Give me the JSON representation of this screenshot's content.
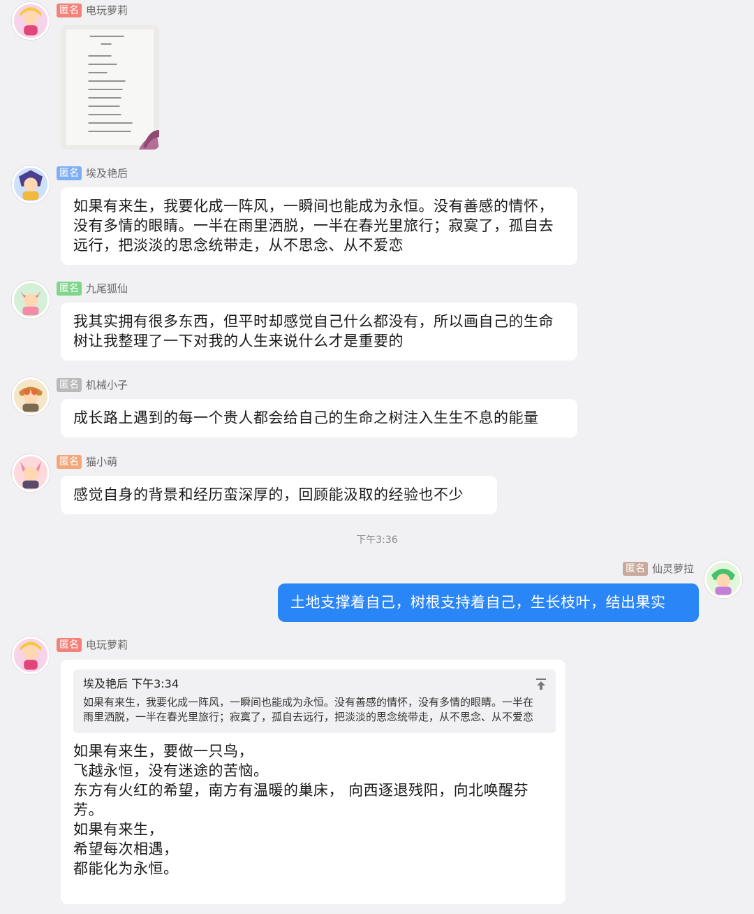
{
  "chat": {
    "anon_label": "匿名",
    "messages": [
      {
        "sender": "电玩萝莉",
        "type": "image"
      },
      {
        "sender": "埃及艳后",
        "text": "如果有来生，我要化成一阵风，一瞬间也能成为永恒。没有善感的情怀，没有多情的眼睛。一半在雨里洒脱，一半在春光里旅行；寂寞了，孤自去远行，把淡淡的思念统带走，从不思念、从不爱恋"
      },
      {
        "sender": "九尾狐仙",
        "text": "我其实拥有很多东西，但平时却感觉自己什么都没有，所以画自己的生命树让我整理了一下对我的人生来说什么才是重要的"
      },
      {
        "sender": "机械小子",
        "text": "成长路上遇到的每一个贵人都会给自己的生命之树注入生生不息的能量"
      },
      {
        "sender": "猫小萌",
        "text": "感觉自身的背景和经历蛮深厚的，回顾能汲取的经验也不少"
      },
      {
        "sender": "仙灵萝拉",
        "text": "土地支撑着自己，树根支持着自己，生长枝叶，结出果实"
      },
      {
        "sender": "电玩萝莉",
        "quote": {
          "sender": "埃及艳后",
          "time": "下午3:34",
          "text": "如果有来生，我要化成一阵风，一瞬间也能成为永恒。没有善感的情怀，没有多情的眼睛。一半在雨里洒脱，一半在春光里旅行；寂寞了，孤自去远行，把淡淡的思念统带走，从不思念、从不爱恋"
        },
        "text": "如果有来生，要做一只鸟，\n飞越永恒，没有迷途的苦恼。\n东方有火红的希望，南方有温暖的巢床， 向西逐退残阳，向北唤醒芬芳。\n如果有来生，\n希望每次相遇，\n都能化为永恒。"
      }
    ],
    "timestamp": "下午3:36"
  },
  "colors": {
    "anon_red": "#f2817a",
    "anon_blue": "#7eaef3",
    "anon_green": "#7fd58c",
    "anon_gray": "#b9b9b9",
    "anon_orange": "#f5a77c",
    "anon_brown": "#c9a99b",
    "my_bubble": "#2a86f7"
  }
}
